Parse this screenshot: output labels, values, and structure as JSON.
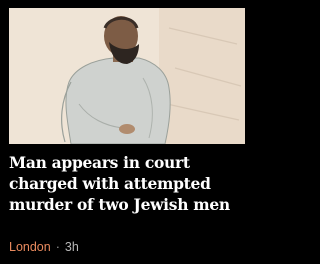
{
  "card": {
    "headline": "Man appears in court charged with attempted murder of two Jewish men",
    "section": "London",
    "separator": "·",
    "time": "3h",
    "image_icon": "court-sketch-image"
  },
  "colors": {
    "background": "#000000",
    "headline": "#ffffff",
    "section": "#e98a5e",
    "time": "#b8b8b8"
  }
}
